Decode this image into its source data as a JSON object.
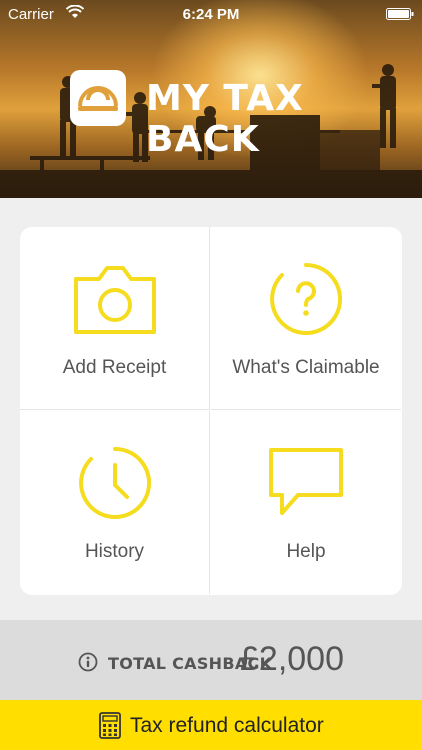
{
  "status_bar": {
    "carrier": "Carrier",
    "time": "6:24 PM"
  },
  "header": {
    "app_name": "MY TAX BACK"
  },
  "menu": {
    "items": [
      {
        "label": "Add Receipt",
        "icon": "camera-icon"
      },
      {
        "label": "What's Claimable",
        "icon": "question-circle-icon"
      },
      {
        "label": "History",
        "icon": "clock-icon"
      },
      {
        "label": "Help",
        "icon": "speech-bubble-icon"
      }
    ]
  },
  "cashback": {
    "label": "TOTAL CASHBACK",
    "amount": "£2,000",
    "icon": "info-icon"
  },
  "calculator": {
    "label": "Tax refund calculator",
    "icon": "calculator-icon"
  },
  "colors": {
    "accent": "#ffde00",
    "icon_yellow": "#f5dc1e",
    "text": "#555555"
  }
}
